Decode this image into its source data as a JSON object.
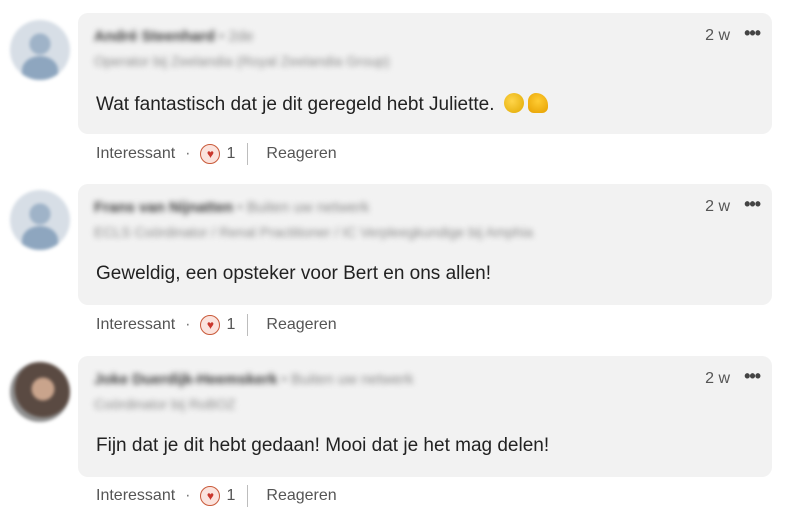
{
  "comments": [
    {
      "author_name": "André Steenhard",
      "author_meta": "• 2de",
      "author_subtitle": "Operator bij Zeelandia (Royal Zeelandia Group)",
      "time": "2 w",
      "more": "•••",
      "text": "Wat fantastisch dat je dit geregeld hebt Juliette.",
      "emojis": [
        "oncoming-fist",
        "thumbs-up"
      ],
      "like_label": "Interessant",
      "separator": "·",
      "reaction_count": "1",
      "reply_label": "Reageren"
    },
    {
      "author_name": "Frans van Nijnatten",
      "author_meta": "• Buiten uw netwerk",
      "author_subtitle": "ECLS Coördinator / Renal Practitioner / IC Verpleegkundige bij Amphia",
      "time": "2 w",
      "more": "•••",
      "text": "Geweldig, een opsteker voor Bert en ons allen!",
      "like_label": "Interessant",
      "separator": "·",
      "reaction_count": "1",
      "reply_label": "Reageren"
    },
    {
      "author_name": "Joke Duerdijk-Heemskerk",
      "author_meta": "• Buiten uw netwerk",
      "author_subtitle": "Coördinator bij RoBOZ",
      "time": "2 w",
      "more": "•••",
      "text": "Fijn dat je dit hebt gedaan! Mooi dat je het mag delen!",
      "like_label": "Interessant",
      "separator": "·",
      "reaction_count": "1",
      "reply_label": "Reageren"
    }
  ],
  "colors": {
    "bubble": "#f2f2f2",
    "reaction_heart": "#c9372c"
  }
}
